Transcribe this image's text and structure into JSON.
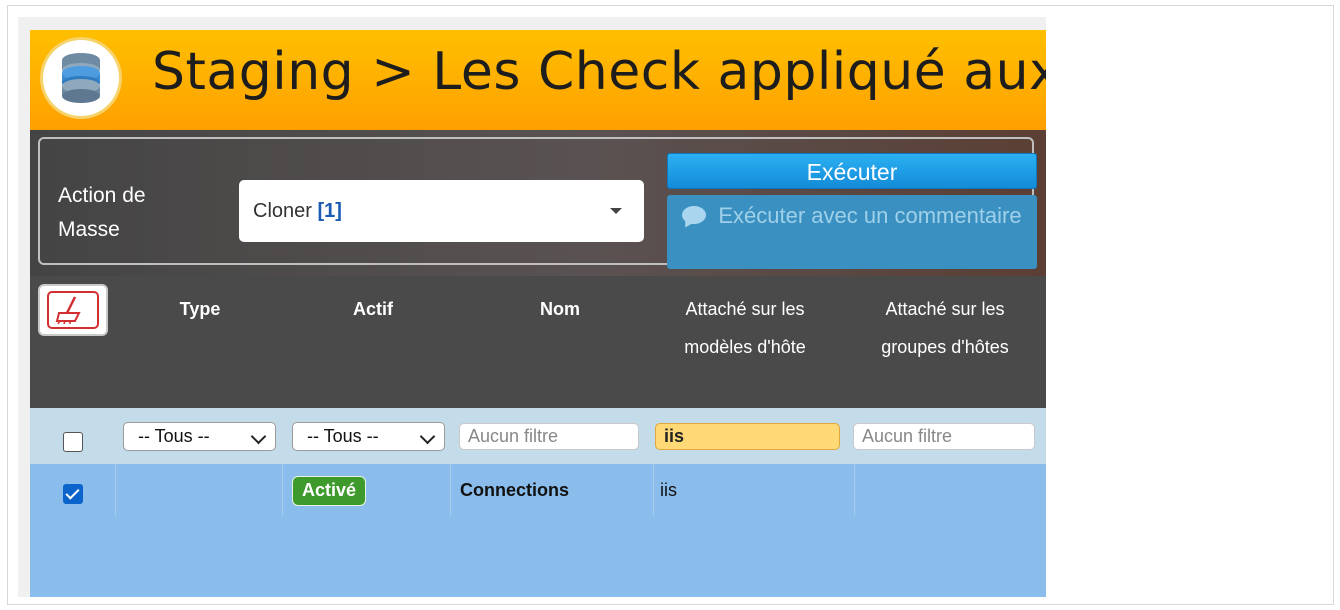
{
  "header": {
    "title": "Staging > Les Check appliqué aux m",
    "logo_icon": "database-icon"
  },
  "mass_action": {
    "label": "Action de Masse",
    "select_text": "Cloner ",
    "select_count": "[1]",
    "execute_label": "Exécuter",
    "execute_comment_label": "Exécuter avec un commentaire",
    "comment_icon": "comment-icon"
  },
  "table": {
    "clear_filters_icon": "broom-icon",
    "columns": [
      {
        "label": "Type"
      },
      {
        "label": "Actif"
      },
      {
        "label": "Nom"
      },
      {
        "label": "Attaché sur les modèles d'hôte"
      },
      {
        "label": "Attaché sur les groupes d'hôtes"
      }
    ],
    "filters": {
      "type": "-- Tous --",
      "actif": "-- Tous --",
      "nom_placeholder": "Aucun filtre",
      "modeles_value": "iis",
      "groupes_placeholder": "Aucun filtre"
    },
    "rows": [
      {
        "checked": true,
        "type": "",
        "actif": "Activé",
        "nom": "Connections",
        "modeles": "iis",
        "groupes": ""
      }
    ]
  },
  "colors": {
    "header_orange": "#ffb000",
    "execute_blue": "#148bd8",
    "active_green": "#3f9a2e",
    "row_selected_blue": "#8abdeb",
    "filter_highlight": "#ffd976"
  }
}
